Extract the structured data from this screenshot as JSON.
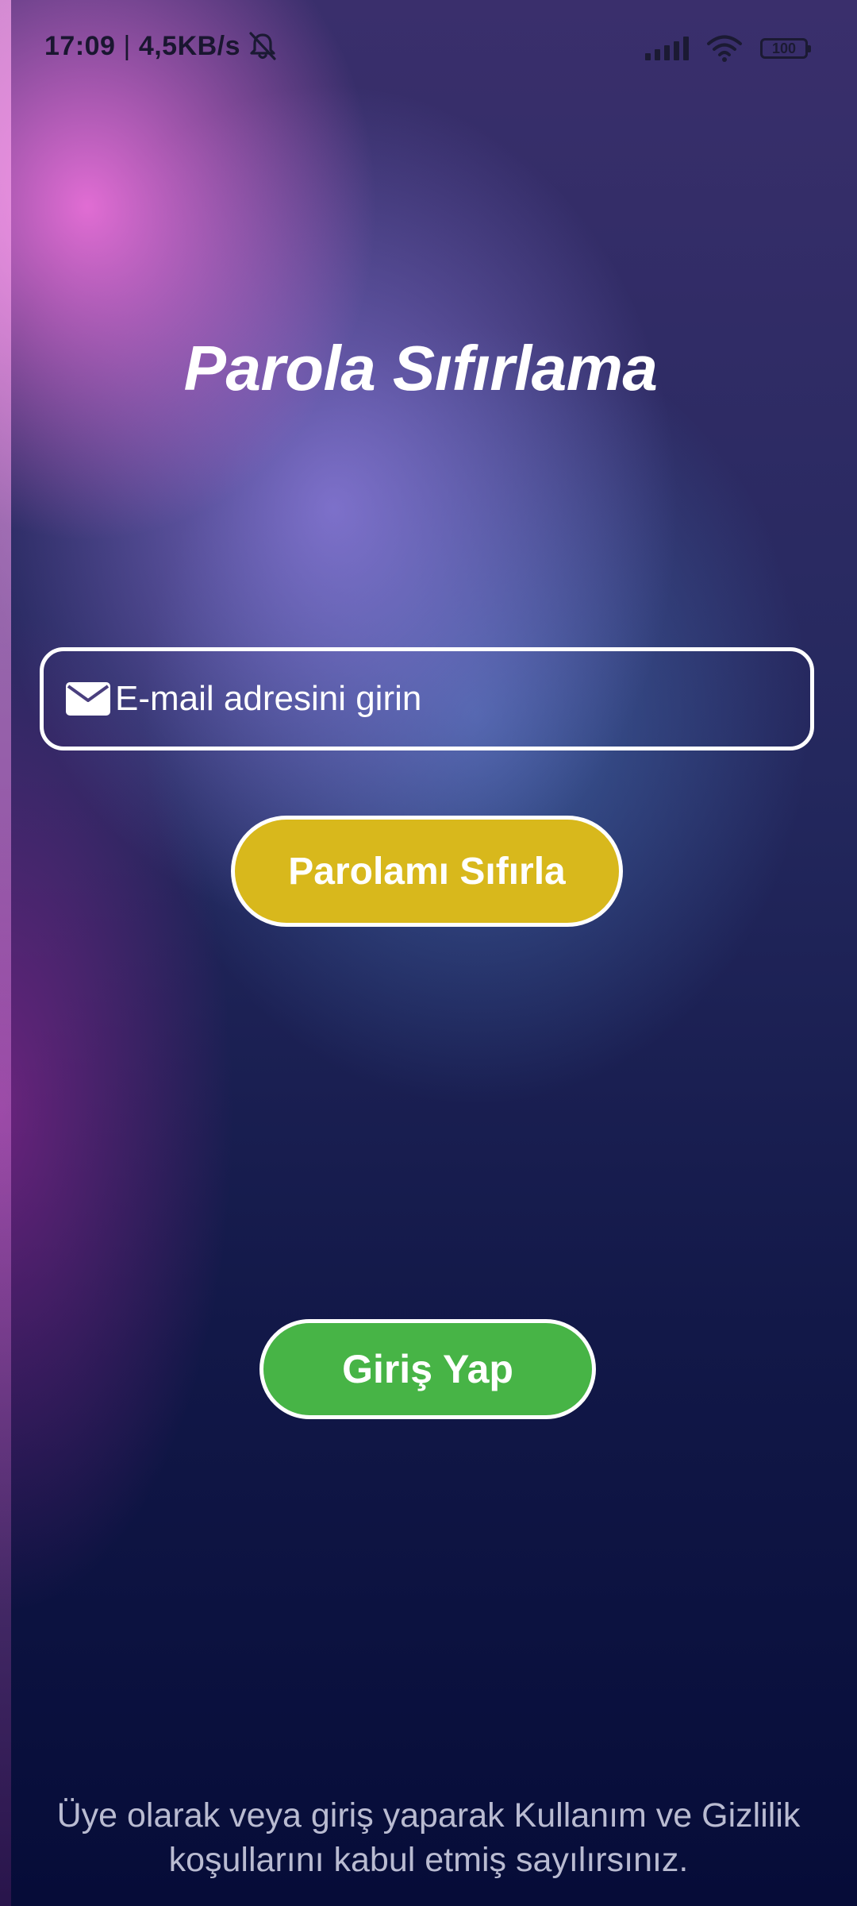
{
  "status_bar": {
    "time": "17:09",
    "separator": "|",
    "network_speed": "4,5KB/s",
    "battery_level": "100",
    "icons": [
      "bell-off-icon",
      "signal-icon",
      "wifi-icon",
      "battery-icon"
    ]
  },
  "page": {
    "title": "Parola Sıfırlama"
  },
  "email_field": {
    "icon": "mail-icon",
    "placeholder": "E-mail adresini girin",
    "value": ""
  },
  "buttons": {
    "reset_label": "Parolamı Sıfırla",
    "reset_color": "#d8b81c",
    "login_label": "Giriş Yap",
    "login_color": "#47b446"
  },
  "footer": {
    "terms_line1": "Üye olarak veya giriş yaparak Kullanım ve Gizlilik",
    "terms_line2": "koşullarını kabul etmiş sayılırsınız."
  }
}
